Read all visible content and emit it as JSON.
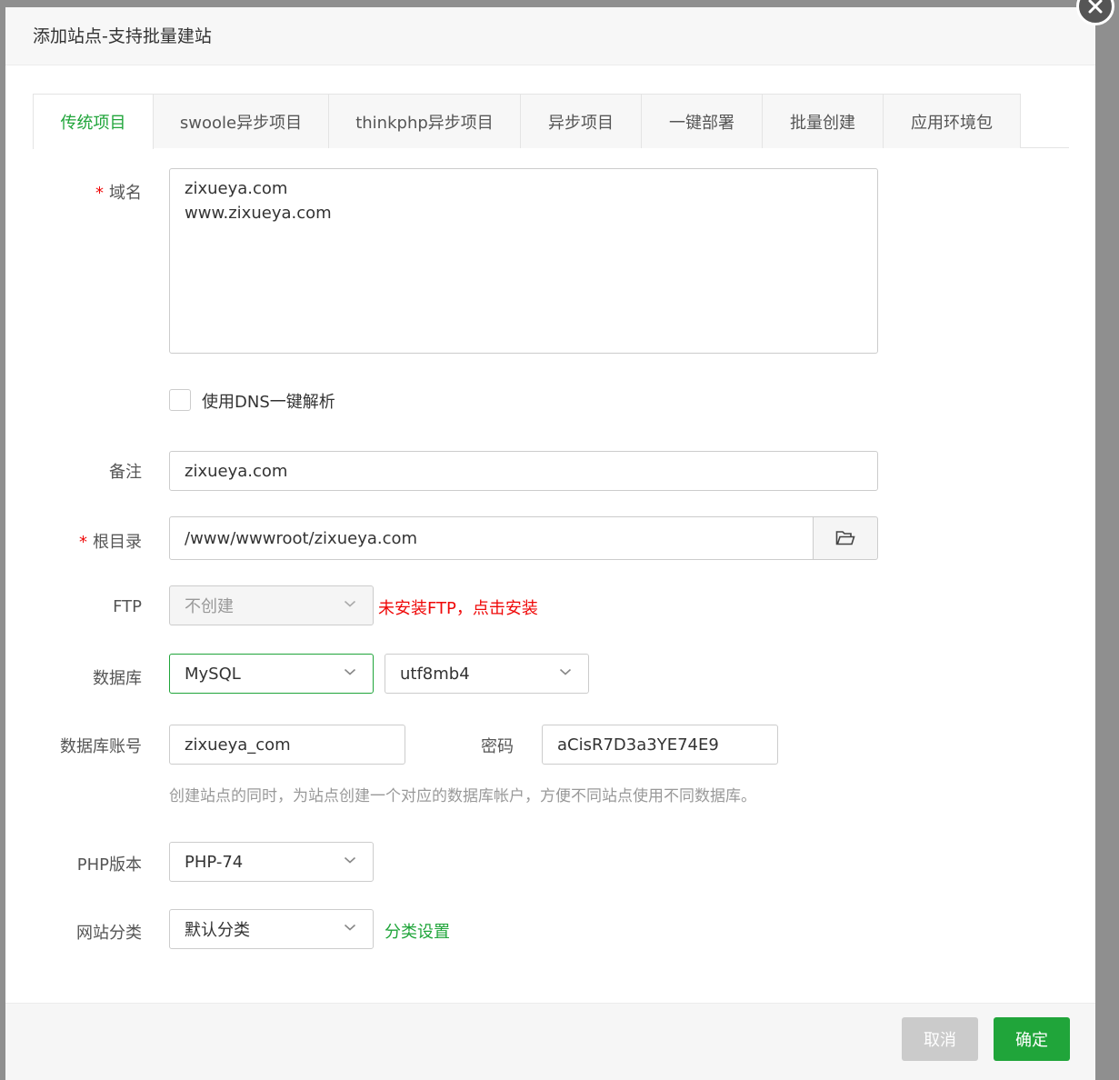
{
  "dialog": {
    "title": "添加站点-支持批量建站",
    "close_icon": "close-icon"
  },
  "tabs": [
    {
      "label": "传统项目",
      "active": true
    },
    {
      "label": "swoole异步项目",
      "active": false
    },
    {
      "label": "thinkphp异步项目",
      "active": false
    },
    {
      "label": "异步项目",
      "active": false
    },
    {
      "label": "一键部署",
      "active": false
    },
    {
      "label": "批量创建",
      "active": false
    },
    {
      "label": "应用环境包",
      "active": false
    }
  ],
  "form": {
    "required_mark": "*",
    "domain": {
      "label": "域名",
      "value": "zixueya.com\nwww.zixueya.com"
    },
    "dns": {
      "label": "使用DNS一键解析",
      "checked": false
    },
    "remark": {
      "label": "备注",
      "value": "zixueya.com"
    },
    "root": {
      "label": "根目录",
      "value": "/www/wwwroot/zixueya.com",
      "icon": "folder-icon"
    },
    "ftp": {
      "label": "FTP",
      "value": "不创建",
      "warning": "未安装FTP，点击安装"
    },
    "database": {
      "label": "数据库",
      "type": "MySQL",
      "charset": "utf8mb4"
    },
    "db_account": {
      "label": "数据库账号",
      "value": "zixueya_com"
    },
    "db_password": {
      "label": "密码",
      "value": "aCisR7D3a3YE74E9"
    },
    "db_hint": "创建站点的同时，为站点创建一个对应的数据库帐户，方便不同站点使用不同数据库。",
    "php": {
      "label": "PHP版本",
      "value": "PHP-74"
    },
    "category": {
      "label": "网站分类",
      "value": "默认分类",
      "link": "分类设置"
    }
  },
  "footer": {
    "cancel_label": "取消",
    "ok_label": "确定"
  },
  "colors": {
    "accent": "#20a53a",
    "danger": "#ef0808"
  }
}
